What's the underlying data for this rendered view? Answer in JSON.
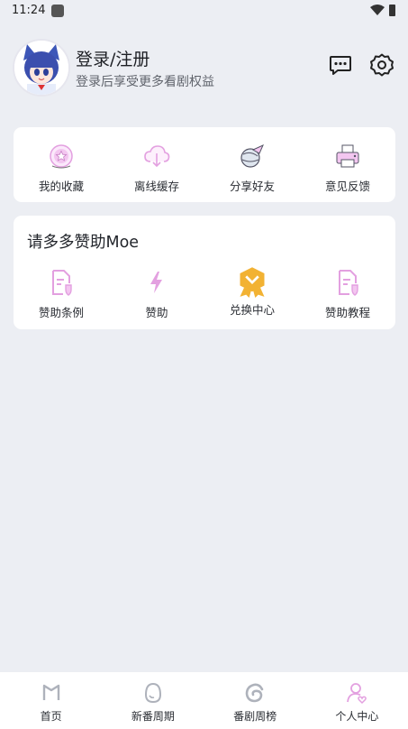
{
  "status": {
    "time": "11:24"
  },
  "profile": {
    "title": "登录/注册",
    "subtitle": "登录后享受更多看剧权益"
  },
  "quick_actions": [
    {
      "label": "我的收藏",
      "icon": "favorite-badge-icon"
    },
    {
      "label": "离线缓存",
      "icon": "cloud-download-icon"
    },
    {
      "label": "分享好友",
      "icon": "share-globe-icon"
    },
    {
      "label": "意见反馈",
      "icon": "feedback-printer-icon"
    }
  ],
  "sponsor": {
    "title": "请多多赞助Moe",
    "items": [
      {
        "label": "赞助条例",
        "icon": "document-shield-icon"
      },
      {
        "label": "赞助",
        "icon": "lightning-icon"
      },
      {
        "label": "兑换中心",
        "icon": "exchange-medal-icon"
      },
      {
        "label": "赞助教程",
        "icon": "document-shield-icon"
      }
    ]
  },
  "tabs": [
    {
      "label": "首页",
      "icon": "home-m-icon",
      "active": false
    },
    {
      "label": "新番周期",
      "icon": "egg-icon",
      "active": false
    },
    {
      "label": "番剧周榜",
      "icon": "swirl-icon",
      "active": false
    },
    {
      "label": "个人中心",
      "icon": "user-heart-icon",
      "active": true
    }
  ],
  "colors": {
    "accent": "#e3a0e0",
    "gold": "#f2b233",
    "bg": "#eceef3"
  }
}
